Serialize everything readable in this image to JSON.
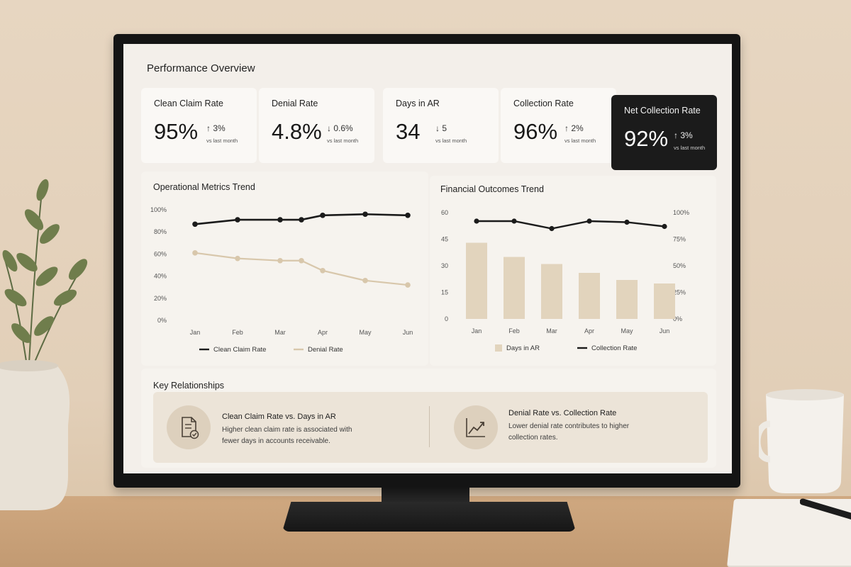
{
  "dashboard": {
    "title": "Performance Overview",
    "kpis": [
      {
        "label": "Clean Claim Rate",
        "value": "95%",
        "delta": "3%",
        "direction": "up",
        "sub": "vs last month"
      },
      {
        "label": "Denial Rate",
        "value": "4.8%",
        "delta": "0.6%",
        "direction": "down",
        "sub": "vs last month"
      },
      {
        "label": "Days in AR",
        "value": "34",
        "delta": "5",
        "direction": "down",
        "sub": "vs last month"
      },
      {
        "label": "Collection Rate",
        "value": "96%",
        "delta": "2%",
        "direction": "up",
        "sub": "vs last month"
      },
      {
        "label": "Net Collection Rate",
        "value": "92%",
        "delta": "3%",
        "direction": "up",
        "sub": "vs last month",
        "highlighted": true
      }
    ],
    "arrows": {
      "up": "↑",
      "down": "↓"
    },
    "relationships": {
      "title": "Key Relationships",
      "items": [
        {
          "icon": "document-check-icon",
          "title": "Clean Claim Rate vs. Days in AR",
          "description": "Higher clean claim rate is associated with fewer days in accounts receivable."
        },
        {
          "icon": "trend-up-icon",
          "title": "Denial Rate vs. Collection Rate",
          "description": "Lower denial rate contributes to higher collection rates."
        }
      ]
    }
  },
  "colors": {
    "dark_series": "#1b1b1b",
    "light_series": "#d8c7ab",
    "bar_fill": "#e2d4bd",
    "axis_text": "#555555"
  },
  "chart_data": [
    {
      "type": "line",
      "title": "Operational Metrics Trend",
      "categories": [
        "Jan",
        "Feb",
        "Mar",
        "Apr",
        "May",
        "Jun"
      ],
      "y_ticks": [
        "0%",
        "20%",
        "40%",
        "60%",
        "80%",
        "100%"
      ],
      "ylim": [
        0,
        100
      ],
      "grid": false,
      "legend": "bottom",
      "series": [
        {
          "name": "Clean Claim Rate",
          "values": [
            87,
            91,
            91,
            91,
            95,
            96,
            95
          ],
          "x": [
            0,
            1,
            2,
            2.5,
            3,
            4,
            5
          ]
        },
        {
          "name": "Denial Rate",
          "values": [
            61,
            56,
            54,
            54,
            45,
            36,
            32
          ],
          "x": [
            0,
            1,
            2,
            2.5,
            3,
            4,
            5
          ]
        }
      ]
    },
    {
      "type": "bar",
      "title": "Financial Outcomes Trend",
      "categories": [
        "Jan",
        "Feb",
        "Mar",
        "Apr",
        "May",
        "Jun"
      ],
      "y_ticks": [
        "0",
        "15",
        "30",
        "45",
        "60"
      ],
      "ylim": [
        0,
        60
      ],
      "y2_ticks": [
        "0%",
        "25%",
        "50%",
        "75%",
        "100%"
      ],
      "y2lim": [
        0,
        100
      ],
      "grid": false,
      "legend": "bottom",
      "series": [
        {
          "name": "Days in AR",
          "type": "bar",
          "axis": "left",
          "values": [
            43,
            35,
            31,
            26,
            22,
            20
          ]
        },
        {
          "name": "Collection Rate",
          "type": "line",
          "axis": "right",
          "values": [
            92,
            92,
            85,
            92,
            91,
            87
          ]
        }
      ]
    }
  ]
}
